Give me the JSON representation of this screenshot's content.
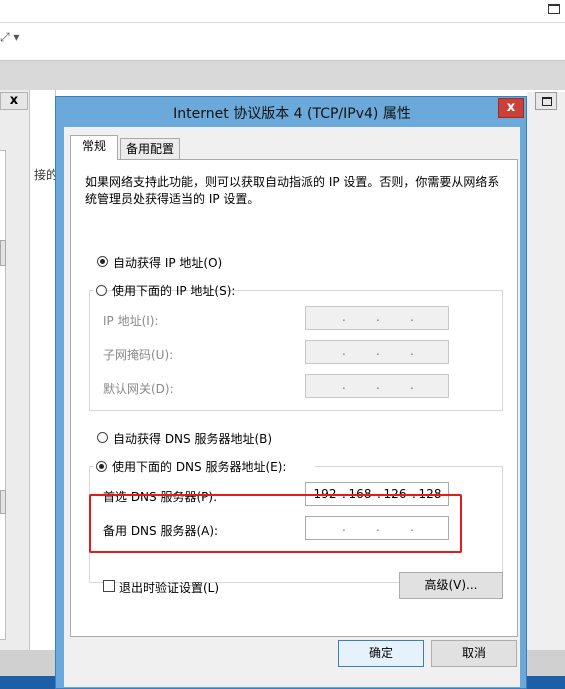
{
  "dialog": {
    "title": "Internet 协议版本 4 (TCP/IPv4) 属性",
    "close_glyph": "x"
  },
  "tabs": [
    {
      "label": "常规",
      "active": true
    },
    {
      "label": "备用配置",
      "active": false
    }
  ],
  "description": "如果网络支持此功能，则可以获取自动指派的 IP 设置。否则，你需要从网络系统管理员处获得适当的 IP 设置。",
  "ip_mode": {
    "auto_label": "自动获得 IP 地址(O)",
    "manual_label": "使用下面的 IP 地址(S):",
    "selected": "auto",
    "fields": [
      {
        "label": "IP 地址(I):",
        "value": ". . ."
      },
      {
        "label": "子网掩码(U):",
        "value": ". . ."
      },
      {
        "label": "默认网关(D):",
        "value": ". . ."
      }
    ]
  },
  "dns_mode": {
    "auto_label": "自动获得 DNS 服务器地址(B)",
    "manual_label": "使用下面的 DNS 服务器地址(E):",
    "selected": "manual",
    "preferred": {
      "label": "首选 DNS 服务器(P):",
      "octets": [
        "192",
        "168",
        "126",
        "128"
      ]
    },
    "alternate": {
      "label": "备用 DNS 服务器(A):",
      "value": ". . ."
    }
  },
  "validate_label": "退出时验证设置(L)",
  "advanced_label": "高级(V)...",
  "ok_label": "确定",
  "cancel_label": "取消",
  "background": {
    "side_label": "接的",
    "close_glyph": "x",
    "colors": {
      "accent": "#e21c1c",
      "title_bar": "#6aa9d9",
      "taskbar": "#1c5fa6"
    }
  }
}
